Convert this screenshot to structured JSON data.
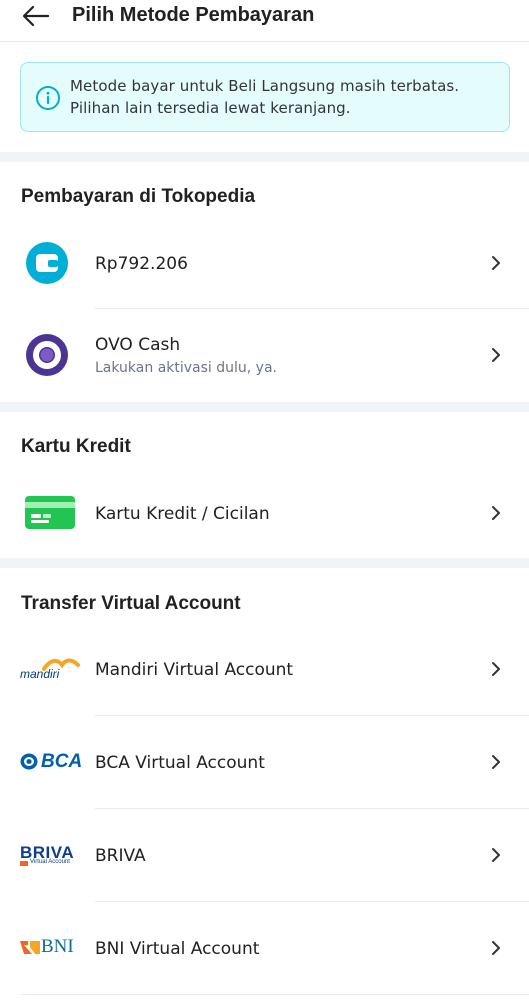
{
  "header": {
    "title": "Pilih Metode Pembayaran",
    "back_icon": "arrow-left-icon"
  },
  "info_banner": {
    "text": "Metode bayar untuk Beli Langsung masih terbatas. Pilihan lain tersedia lewat keranjang.",
    "icon": "info-icon",
    "bg_color": "#e5fcfc",
    "border_color": "#9fe6ea"
  },
  "sections": {
    "tokopedia": {
      "title": "Pembayaran di Tokopedia",
      "items": [
        {
          "label": "Rp792.206",
          "icon": "wallet-icon"
        },
        {
          "label": "OVO Cash",
          "sub": "Lakukan aktivasi dulu, ya.",
          "icon": "ovo-logo-icon"
        }
      ]
    },
    "credit": {
      "title": "Kartu Kredit",
      "items": [
        {
          "label": "Kartu Kredit / Cicilan",
          "icon": "credit-card-icon"
        }
      ]
    },
    "va": {
      "title": "Transfer Virtual Account",
      "items": [
        {
          "label": "Mandiri Virtual Account",
          "icon": "mandiri-logo-icon",
          "logo_text": "mandiri"
        },
        {
          "label": "BCA Virtual Account",
          "icon": "bca-logo-icon",
          "logo_text": "BCA"
        },
        {
          "label": "BRIVA",
          "icon": "briva-logo-icon",
          "logo_text": "BRIVA",
          "logo_sub": "Virtual Account"
        },
        {
          "label": "BNI Virtual Account",
          "icon": "bni-logo-icon",
          "logo_text": "BNI"
        }
      ]
    }
  },
  "colors": {
    "accent_teal": "#03ac0e",
    "wallet_blue": "#00aed6",
    "ovo_purple": "#4c3494",
    "card_green": "#23c552"
  }
}
